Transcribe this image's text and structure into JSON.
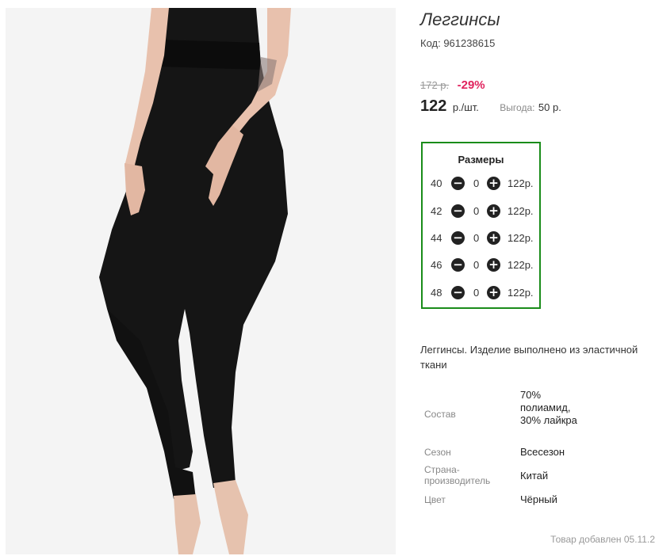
{
  "product": {
    "title": "Леггинсы",
    "code": "Код: 961238615",
    "old_price": "172 р.",
    "discount": "-29%",
    "price": "122",
    "price_unit": "р./шт.",
    "savings_label": "Выгода:",
    "savings_value": "50 р.",
    "image_icon": "leggings-photo"
  },
  "sizes": {
    "title": "Размеры",
    "minus_symbol": "−",
    "plus_symbol": "+",
    "rows": [
      {
        "size": "40",
        "qty": "0",
        "price": "122р."
      },
      {
        "size": "42",
        "qty": "0",
        "price": "122р."
      },
      {
        "size": "44",
        "qty": "0",
        "price": "122р."
      },
      {
        "size": "46",
        "qty": "0",
        "price": "122р."
      },
      {
        "size": "48",
        "qty": "0",
        "price": "122р."
      }
    ]
  },
  "description": "Леггинсы. Изделие выполнено из эластичной ткани",
  "attributes": [
    {
      "label": "Состав",
      "value": "70% полиамид, 30% лайкра"
    },
    {
      "label": "Сезон",
      "value": "Всесезон"
    },
    {
      "label": "Страна-производитель",
      "value": "Китай"
    },
    {
      "label": "Цвет",
      "value": "Чёрный"
    }
  ],
  "added_text": "Товар добавлен 05.11.2",
  "colors": {
    "accent_green": "#1a8c1a",
    "discount_red": "#e0245e"
  }
}
